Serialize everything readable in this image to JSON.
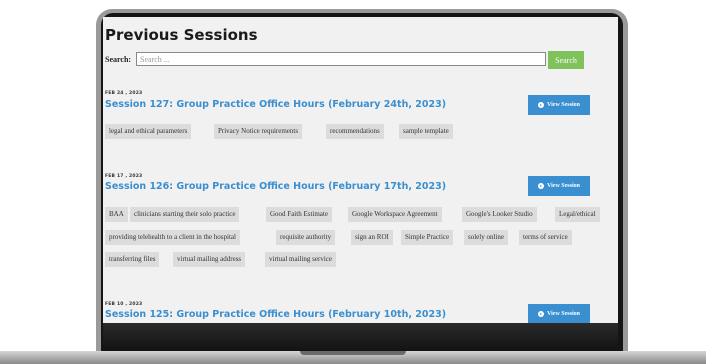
{
  "page": {
    "title": "Previous Sessions"
  },
  "search": {
    "label": "Search:",
    "placeholder": "Search ...",
    "button": "Search"
  },
  "view_label": "View Session",
  "sessions": [
    {
      "date": "FEB 24 , 2023",
      "title": "Session 127: Group Practice Office Hours (February 24th, 2023)",
      "tags": [
        "legal and ethical parameters",
        "Privacy Notice requirements",
        "recommendations",
        "sample template"
      ]
    },
    {
      "date": "FEB 17 , 2023",
      "title": "Session 126: Group Practice Office Hours (February 17th, 2023)",
      "tags": [
        "BAA",
        "clinicians starting their solo practice",
        "Good Faith Estimate",
        "Google Workspace Agreement",
        "Google's Looker Studio",
        "Legal/ethical",
        "providing telehealth to a client in the hospital",
        "requisite authority",
        "sign an ROI",
        "Simple Practice",
        "solely online",
        "terms of service",
        "transferring files",
        "virtual mailing address",
        "virtual mailing service"
      ]
    },
    {
      "date": "FEB 10 , 2023",
      "title": "Session 125: Group Practice Office Hours (February 10th, 2023)",
      "tags": []
    }
  ]
}
